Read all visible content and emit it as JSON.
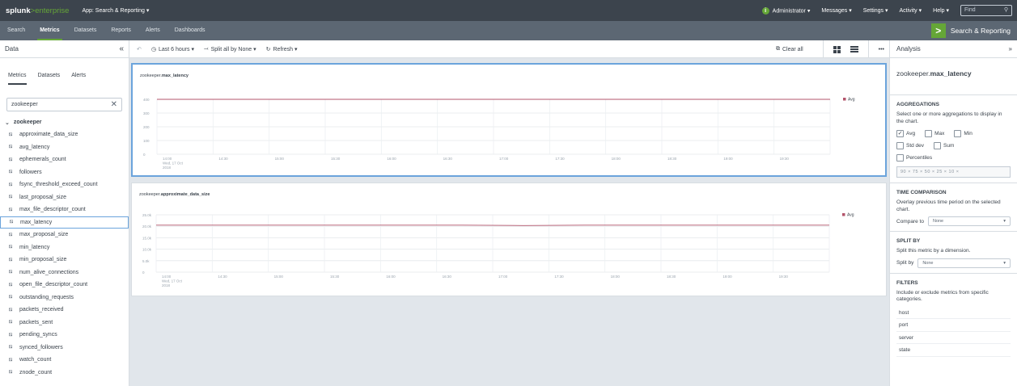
{
  "topbar": {
    "logo_main": "splunk",
    "logo_gt": ">",
    "logo_suffix": "enterprise",
    "app_label": "App: Search & Reporting ▾",
    "admin": "Administrator ▾",
    "messages": "Messages ▾",
    "settings": "Settings ▾",
    "activity": "Activity ▾",
    "help": "Help ▾",
    "find_placeholder": "Find"
  },
  "nav": {
    "items": [
      "Search",
      "Metrics",
      "Datasets",
      "Reports",
      "Alerts",
      "Dashboards"
    ],
    "brand": "Search & Reporting"
  },
  "left": {
    "title": "Data",
    "tabs": [
      "Metrics",
      "Datasets",
      "Alerts"
    ],
    "search_value": "zookeeper",
    "group": "zookeeper",
    "items": [
      "approximate_data_size",
      "avg_latency",
      "ephemerals_count",
      "followers",
      "fsync_threshold_exceed_count",
      "last_proposal_size",
      "max_file_descriptor_count",
      "max_latency",
      "max_proposal_size",
      "min_latency",
      "min_proposal_size",
      "num_alive_connections",
      "open_file_descriptor_count",
      "outstanding_requests",
      "packets_received",
      "packets_sent",
      "pending_syncs",
      "synced_followers",
      "watch_count",
      "znode_count"
    ],
    "selected_index": 7
  },
  "toolbar": {
    "undo": "↶",
    "time": "Last 6 hours ▾",
    "split": "Split all by None ▾",
    "refresh": "Refresh ▾",
    "clear": "Clear all",
    "more": "•••"
  },
  "chart_data": [
    {
      "type": "line",
      "title_prefix": "zookeeper.",
      "title_metric": "max_latency",
      "x": [
        "14:00\nWed, 17 Oct\n2018",
        "14:30",
        "15:00",
        "15:30",
        "16:00",
        "16:30",
        "17:00",
        "17:30",
        "18:00",
        "18:30",
        "19:00",
        "19:30"
      ],
      "yticks": [
        "400",
        "300",
        "200",
        "100",
        "0"
      ],
      "ylim": [
        0,
        400
      ],
      "series": [
        {
          "name": "Avg",
          "color": "#b3546b",
          "values": [
            400,
            400,
            400,
            400,
            400,
            400,
            400,
            400,
            400,
            400,
            400,
            400
          ]
        }
      ],
      "legend": "top-right"
    },
    {
      "type": "line",
      "title_prefix": "zookeeper.",
      "title_metric": "approximate_data_size",
      "x": [
        "14:00\nWed, 17 Oct\n2018",
        "14:30",
        "15:00",
        "15:30",
        "16:00",
        "16:30",
        "17:00",
        "17:30",
        "18:00",
        "18:30",
        "19:00",
        "19:30"
      ],
      "yticks": [
        "25.0k",
        "20.0k",
        "15.0k",
        "10.0k",
        "5.0k",
        "0"
      ],
      "ylim": [
        0,
        25000
      ],
      "series": [
        {
          "name": "Avg",
          "color": "#b3546b",
          "values": [
            20500,
            20500,
            20500,
            20500,
            20500,
            20500,
            20300,
            20500,
            20500,
            20500,
            20500,
            20500
          ]
        }
      ],
      "legend": "top-right"
    }
  ],
  "right": {
    "title": "Analysis",
    "metric_prefix": "zookeeper.",
    "metric_name": "max_latency",
    "aggregations": {
      "heading": "AGGREGATIONS",
      "desc": "Select one or more aggregations to display in the chart.",
      "options": [
        "Avg",
        "Max",
        "Min",
        "Std dev",
        "Sum",
        "Percentiles"
      ],
      "checked": [
        "Avg"
      ],
      "percentiles": "90 × 75 × 50 × 25 × 10 ×"
    },
    "time_comparison": {
      "heading": "TIME COMPARISON",
      "desc": "Overlay previous time period on the selected chart.",
      "label": "Compare to",
      "value": "None"
    },
    "split_by": {
      "heading": "SPLIT BY",
      "desc": "Split this metric by a dimension.",
      "label": "Split by",
      "value": "None"
    },
    "filters": {
      "heading": "FILTERS",
      "desc": "Include or exclude metrics from specific categories.",
      "items": [
        "host",
        "port",
        "server",
        "state"
      ]
    }
  }
}
